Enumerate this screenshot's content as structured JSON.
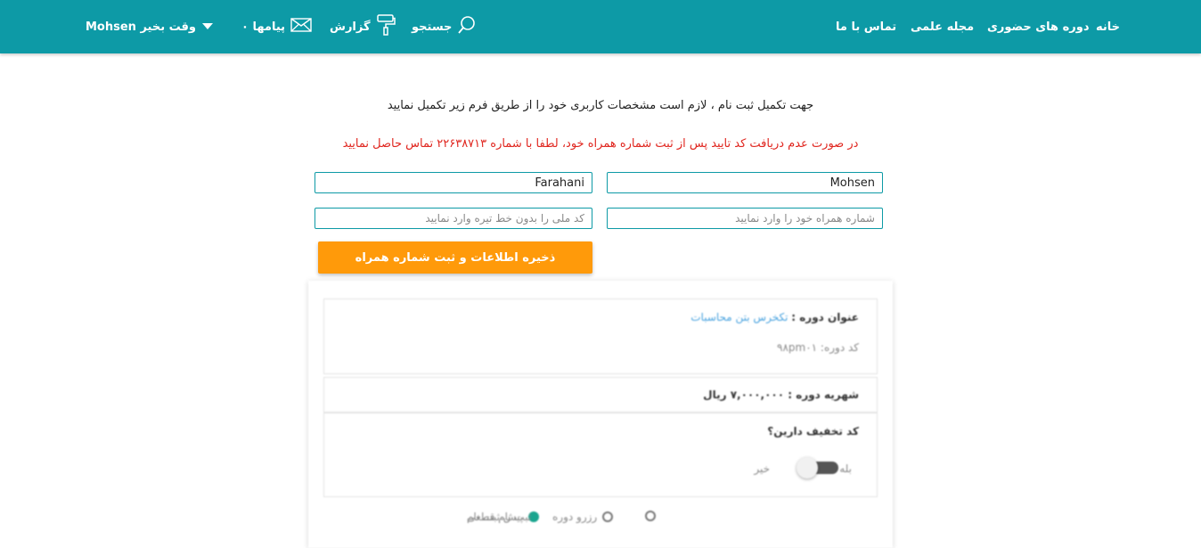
{
  "nav": {
    "home": "خانه",
    "courses": "دوره های حضوری",
    "journal": "مجله علمی",
    "contact": "تماس با ما",
    "search": "جستجو",
    "report": "گزارش",
    "messages": "پیامها ۰",
    "greeting": "Mohsen وقت بخیر"
  },
  "intro": {
    "line1": "جهت تکمیل ثبت نام ، لازم است مشخصات کاربری خود را از طریق فرم زیر تکمیل نمایید",
    "line2": "در صورت عدم دریافت کد تایید پس از ثبت شماره همراه خود، لطفا با شماره ۲۲۶۳۸۷۱۳ تماس حاصل نمایید"
  },
  "form": {
    "first_name": "Mohsen",
    "last_name": "Farahani",
    "mobile_placeholder": "شماره همراه خود را وارد نمایید",
    "national_id_placeholder": "کد ملی را بدون خط تیره وارد نمایید",
    "save_label": "ذخیره اطلاعات و ثبت شماره همراه"
  },
  "course": {
    "title_label": "عنوان دوره :",
    "title_value": "تکخرس بتن محاسبات",
    "code_label": "کد دوره: ۹۸pm۰۱",
    "fee": "شهریه دوره : ۷,۰۰۰,۰۰۰ ریال",
    "discount_question": "کد تخفیف دارین؟",
    "yes": "بله",
    "no": "خیر",
    "radio_reserve": "رزرو دوره",
    "radio_pre": "پیش ثبت نام",
    "radio_final": "ثبت نام قطعی"
  },
  "colors": {
    "header": "#0d9aa6",
    "save_button": "#ff9a0a",
    "alert_text": "#e0261f"
  }
}
